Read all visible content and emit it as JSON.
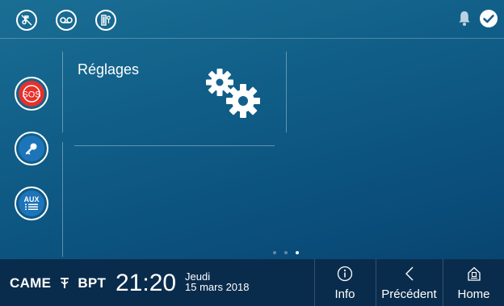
{
  "topbar": {
    "icons": [
      "music-mute-icon",
      "voicemail-icon",
      "door-key-icon"
    ],
    "status_icons": [
      "bell-icon",
      "check-circle-icon"
    ]
  },
  "side_buttons": [
    {
      "name": "sos-button",
      "label": "SOS",
      "color": "#e5312b"
    },
    {
      "name": "key-button",
      "icon": "key-icon",
      "color": "#1d74b9"
    },
    {
      "name": "aux-button",
      "label": "AUX",
      "color": "#1d74b9"
    }
  ],
  "tile": {
    "label": "Réglages",
    "icon": "gears-icon"
  },
  "pagination": {
    "pages": 3,
    "active": 3
  },
  "bottombar": {
    "brand": "CAME",
    "brand2": "BPT",
    "time": "21:20",
    "day": "Jeudi",
    "date": "15 mars 2018",
    "nav": {
      "info": "Info",
      "previous": "Précédent",
      "home": "Home"
    }
  },
  "colors": {
    "accent_red": "#e5312b",
    "accent_blue": "#1d74b9",
    "bottom_bg": "#0a2c4c"
  }
}
